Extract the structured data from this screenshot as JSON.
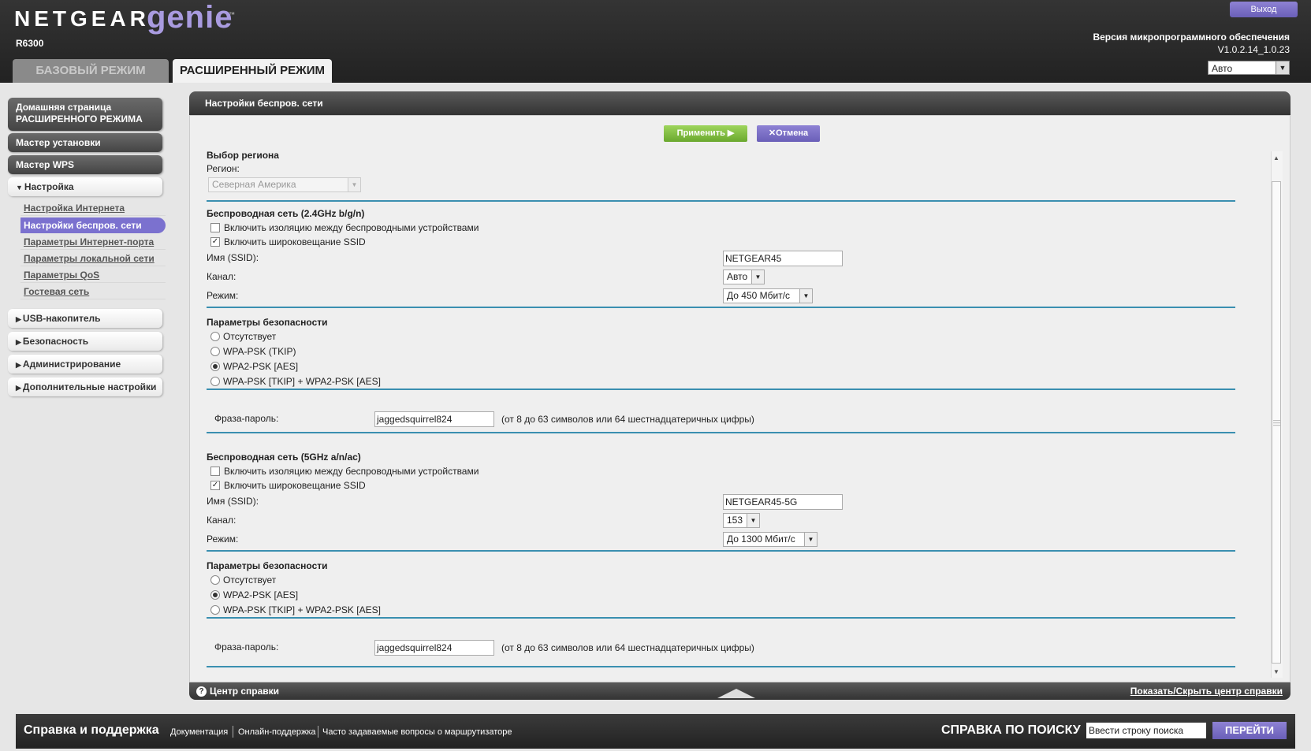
{
  "header": {
    "brand": "NETGEAR",
    "product": "genie",
    "tm": "™",
    "model": "R6300",
    "logout": "Выход",
    "firmware_label": "Версия микропрограммного обеспечения",
    "firmware_version": "V1.0.2.14_1.0.23",
    "language": "Авто",
    "tab_basic": "БАЗОВЫЙ РЕЖИМ",
    "tab_advanced": "РАСШИРЕННЫЙ РЕЖИМ"
  },
  "sidebar": {
    "home_line1": "Домашняя страница",
    "home_line2": "РАСШИРЕННОГО РЕЖИМА",
    "setup_wizard": "Мастер установки",
    "wps_wizard": "Мастер WPS",
    "setup": "Настройка",
    "sub": [
      "Настройка Интернета",
      "Настройки беспров. сети",
      "Параметры Интернет-порта",
      "Параметры локальной сети",
      "Параметры QoS",
      "Гостевая сеть"
    ],
    "usb": "USB-накопитель",
    "security": "Безопасность",
    "admin": "Администрирование",
    "advanced": "Дополнительные настройки"
  },
  "panel": {
    "title": "Настройки беспров. сети",
    "apply": "Применить ▶",
    "cancel": "Отмена"
  },
  "region": {
    "heading": "Выбор региона",
    "label": "Регион:",
    "value": "Северная Америка"
  },
  "wifi24": {
    "heading": "Беспроводная сеть (2.4GHz b/g/n)",
    "isolation_label": "Включить изоляцию между беспроводными устройствами",
    "isolation_checked": false,
    "broadcast_label": "Включить широковещание SSID",
    "broadcast_checked": true,
    "ssid_label": "Имя (SSID):",
    "ssid": "NETGEAR45",
    "channel_label": "Канал:",
    "channel": "Авто",
    "mode_label": "Режим:",
    "mode": "До 450 Мбит/с",
    "security_heading": "Параметры безопасности",
    "security_options": [
      "Отсутствует",
      "WPA-PSK (TKIP)",
      "WPA2-PSK [AES]",
      "WPA-PSK [TKIP] + WPA2-PSK [AES]"
    ],
    "security_selected": "WPA2-PSK [AES]",
    "passphrase_label": "Фраза-пароль:",
    "passphrase": "jaggedsquirrel824",
    "passphrase_hint": "(от 8 до 63 символов или 64 шестнадцатеричных цифры)"
  },
  "wifi5": {
    "heading": "Беспроводная сеть (5GHz a/n/ac)",
    "isolation_label": "Включить изоляцию между беспроводными устройствами",
    "isolation_checked": false,
    "broadcast_label": "Включить широковещание SSID",
    "broadcast_checked": true,
    "ssid_label": "Имя (SSID):",
    "ssid": "NETGEAR45-5G",
    "channel_label": "Канал:",
    "channel": "153",
    "mode_label": "Режим:",
    "mode": "До 1300 Мбит/с",
    "security_heading": "Параметры безопасности",
    "security_options": [
      "Отсутствует",
      "WPA2-PSK [AES]",
      "WPA-PSK [TKIP] + WPA2-PSK [AES]"
    ],
    "security_selected": "WPA2-PSK [AES]",
    "passphrase_label": "Фраза-пароль:",
    "passphrase": "jaggedsquirrel824",
    "passphrase_hint": "(от 8 до 63 символов или 64 шестнадцатеричных цифры)"
  },
  "helpbar": {
    "icon": "?",
    "label": "Центр справки",
    "toggle": "Показать/Скрыть центр справки"
  },
  "footer": {
    "title": "Справка и поддержка",
    "links": [
      "Документация",
      "Онлайн-поддержка",
      "Часто задаваемые вопросы о маршрутизаторе"
    ],
    "search_title": "СПРАВКА ПО ПОИСКУ",
    "search_placeholder": "Ввести строку поиска",
    "go": "ПЕРЕЙТИ"
  },
  "colors": {
    "accent_purple": "#7b71cf",
    "apply_green": "#7cba3f",
    "rule_blue": "#3a8fb0"
  }
}
